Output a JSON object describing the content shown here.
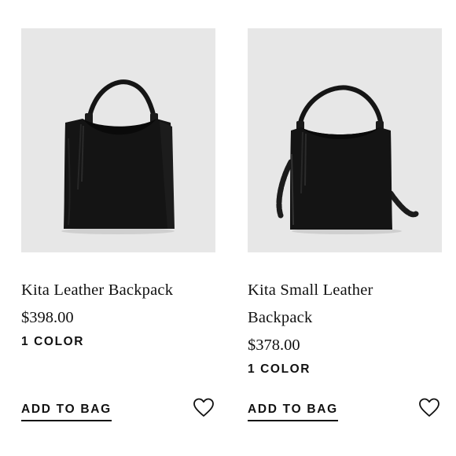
{
  "products": [
    {
      "name": "Kita Leather Backpack",
      "price": "$398.00",
      "colors": "1 COLOR",
      "add_to_bag": "ADD TO BAG",
      "image_icon": "black-leather-hobo-backpack-image",
      "wishlist_icon": "heart-outline-icon"
    },
    {
      "name": "Kita Small Leather Backpack",
      "price": "$378.00",
      "colors": "1 COLOR",
      "add_to_bag": "ADD TO BAG",
      "image_icon": "black-small-leather-backpack-image",
      "wishlist_icon": "heart-outline-icon"
    }
  ],
  "colors": {
    "image_background": "#e7e7e7",
    "text": "#111111",
    "bag": "#121212"
  }
}
